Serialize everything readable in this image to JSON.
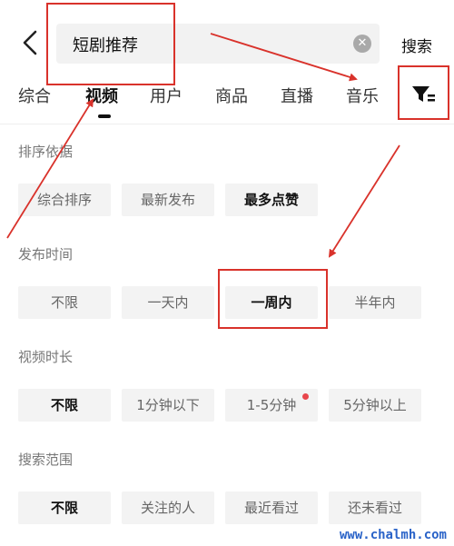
{
  "header": {
    "query": "短剧推荐",
    "search_label": "搜索"
  },
  "tabs": [
    {
      "label": "综合"
    },
    {
      "label": "视频"
    },
    {
      "label": "用户"
    },
    {
      "label": "商品"
    },
    {
      "label": "直播"
    },
    {
      "label": "音乐"
    }
  ],
  "active_tab": "视频",
  "filters": [
    {
      "title": "排序依据",
      "options": [
        "综合排序",
        "最新发布",
        "最多点赞"
      ],
      "selected": "最多点赞"
    },
    {
      "title": "发布时间",
      "options": [
        "不限",
        "一天内",
        "一周内",
        "半年内"
      ],
      "selected": "一周内"
    },
    {
      "title": "视频时长",
      "options": [
        "不限",
        "1分钟以下",
        "1-5分钟",
        "5分钟以上"
      ],
      "selected": "不限"
    },
    {
      "title": "搜索范围",
      "options": [
        "不限",
        "关注的人",
        "最近看过",
        "还未看过"
      ],
      "selected": "不限"
    }
  ],
  "watermark": "www.chalmh.com",
  "colors": {
    "annotation_red": "#d9322b",
    "chip_bg": "#f3f3f3",
    "dot_red": "#e8464c",
    "watermark_blue": "#2a63c8"
  },
  "icons": {
    "back": "chevron-left-icon",
    "clear": "clear-x-circle-icon",
    "filter": "filter-funnel-icon"
  }
}
